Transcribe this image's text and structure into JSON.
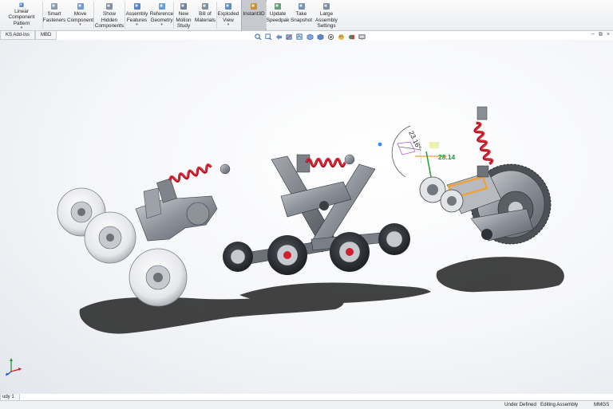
{
  "ribbon": {
    "buttons": [
      {
        "label": "Linear Component\nPattern",
        "icon": "linear-pattern-icon",
        "dropdown": true
      },
      {
        "label": "Smart\nFasteners",
        "icon": "smart-fasteners-icon",
        "dropdown": false
      },
      {
        "label": "Move\nComponent",
        "icon": "move-component-icon",
        "dropdown": true
      },
      {
        "label": "Show\nHidden\nComponents",
        "icon": "show-hidden-icon",
        "dropdown": false
      },
      {
        "label": "Assembly\nFeatures",
        "icon": "assembly-features-icon",
        "dropdown": true
      },
      {
        "label": "Reference\nGeometry",
        "icon": "reference-geometry-icon",
        "dropdown": true
      },
      {
        "label": "New\nMotion\nStudy",
        "icon": "motion-study-icon",
        "dropdown": false
      },
      {
        "label": "Bill of\nMaterials",
        "icon": "bill-of-materials-icon",
        "dropdown": false
      },
      {
        "label": "Exploded\nView",
        "icon": "exploded-view-icon",
        "dropdown": true
      },
      {
        "label": "Instant3D",
        "icon": "instant3d-icon",
        "dropdown": false
      },
      {
        "label": "Update\nSpeedpak",
        "icon": "speedpak-icon",
        "dropdown": false
      },
      {
        "label": "Take\nSnapshot",
        "icon": "snapshot-icon",
        "dropdown": false
      },
      {
        "label": "Large\nAssembly\nSettings",
        "icon": "large-assembly-icon",
        "dropdown": false
      }
    ],
    "active_index": 9,
    "dropdown_glyph": "▾"
  },
  "tabs": [
    "KS Add-Ins",
    "MBD"
  ],
  "heads_up_icons": [
    "zoom-to-fit-icon",
    "zoom-area-icon",
    "previous-view-icon",
    "section-view-icon",
    "dynamic-annotation-icon",
    "view-orientation-icon",
    "display-style-icon",
    "hide-show-icon",
    "edit-appearance-icon",
    "apply-scene-icon",
    "view-settings-icon"
  ],
  "window_controls": [
    "−",
    "⧉",
    "×"
  ],
  "dimensions": {
    "angle": "23.16°",
    "distance": "28.14"
  },
  "bottom_tab": "udy 1",
  "status": {
    "under_defined": "Under Defined",
    "editing": "Editing Assembly",
    "units": "MMGS"
  },
  "colors": {
    "ribbon_active": "#c6c9ce",
    "spring_red": "#d0192a",
    "dimension_green": "#1e9a3a",
    "drag_orange": "#f1a233"
  }
}
